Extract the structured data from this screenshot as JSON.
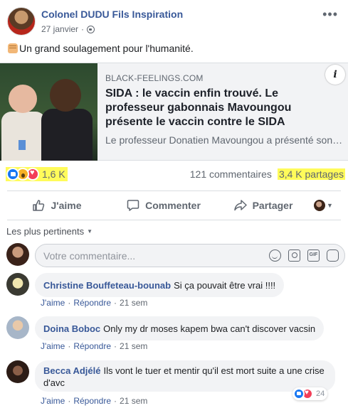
{
  "post": {
    "author": "Colonel DUDU Fils Inspiration",
    "date": "27 janvier",
    "separator": "·",
    "more_icon": "more-horizontal-icon",
    "text": "Un grand soulagement pour l'humanité."
  },
  "link_card": {
    "domain": "BLACK-FEELINGS.COM",
    "title": "SIDA : le vaccin enfin trouvé. Le professeur gabonnais Mavoungou présente le vaccin contre le SIDA",
    "description": "Le professeur Donatien Mavoungou a présenté son vaccin contre le SIDA",
    "info_label": "i"
  },
  "stats": {
    "reactions_count": "1,6 K",
    "comments": "121 commentaires",
    "shares": "3,4 K partages",
    "highlight_color": "#fffb5a"
  },
  "actions": {
    "like": "J'aime",
    "comment": "Commenter",
    "share": "Partager"
  },
  "comments_section": {
    "sort_label": "Les plus pertinents",
    "composer_placeholder": "Votre commentaire...",
    "gif_label": "GIF",
    "items": [
      {
        "name": "Christine Bouffeteau-bounab",
        "text": "Si ça pouvait être vrai !!!!",
        "like": "J'aime",
        "reply": "Répondre",
        "time": "21 sem"
      },
      {
        "name": "Doina Boboc",
        "text": "Only my dr moses kapem bwa can't discover vacsin",
        "like": "J'aime",
        "reply": "Répondre",
        "time": "21 sem"
      },
      {
        "name": "Becca Adjélé",
        "text": "Ils vont le tuer et mentir qu'il est mort suite a une crise d'avc",
        "like": "J'aime",
        "reply": "Répondre",
        "time": "21 sem",
        "reactions": "24"
      }
    ]
  },
  "colors": {
    "link": "#385898",
    "secondary": "#606770",
    "like_blue": "#1877f2",
    "love_red": "#f33e58",
    "wow_yellow": "#f7b125"
  }
}
